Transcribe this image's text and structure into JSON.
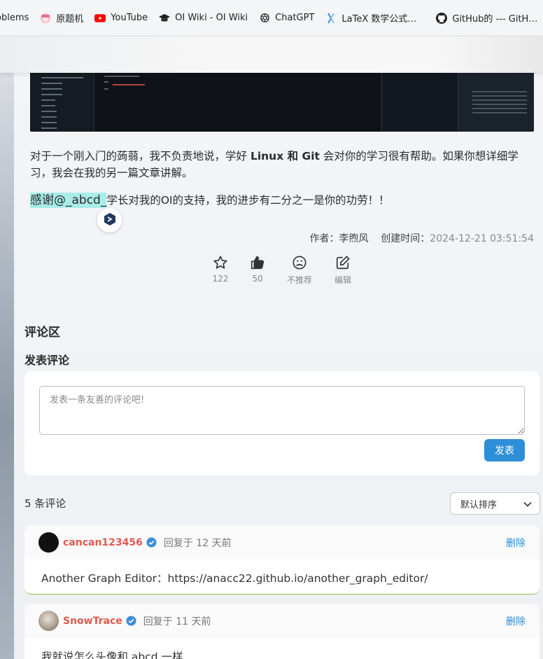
{
  "bookmarks": [
    {
      "label": "oblems",
      "icon": "none"
    },
    {
      "label": "原题机",
      "icon": "anime-avatar-icon"
    },
    {
      "label": "YouTube",
      "icon": "youtube-icon"
    },
    {
      "label": "OI Wiki - OI Wiki",
      "icon": "graduation-cap-icon"
    },
    {
      "label": "ChatGPT",
      "icon": "chatgpt-icon"
    },
    {
      "label": "LaTeX 数学公式…",
      "icon": "latex-icon"
    },
    {
      "label": "GitHub的 --- GitH…",
      "icon": "github-icon"
    }
  ],
  "article": {
    "para1_pre": "对于一个刚入门的蒟蒻，我不负责地说，学好 ",
    "para1_bold": "Linux 和 Git",
    "para1_post": " 会对你的学习很有帮助。如果你想详细学习，我会在我的另一篇文章讲解。",
    "para2_highlight": "感谢@_abcd_",
    "para2_rest": "学长对我的OI的支持，我的进步有二分之一是你的功劳！！",
    "author_label": "作者：",
    "author": "李煦风",
    "created_label": "创建时间：",
    "created_time": "2024-12-21 03:51:54"
  },
  "actions": {
    "star_count": "122",
    "like_count": "50",
    "dislike_label": "不推荐",
    "edit_label": "编辑"
  },
  "comments_section": {
    "title": "评论区",
    "post_title": "发表评论",
    "placeholder": "发表一条友善的评论吧!",
    "post_button": "发表",
    "count_text": "5 条评论",
    "sort_selected": "默认排序"
  },
  "comments": [
    {
      "user": "cancan123456",
      "reply_time": "回复于 12 天前",
      "delete_label": "删除",
      "body": "Another Graph Editor：https://anacc22.github.io/another_graph_editor/"
    },
    {
      "user": "SnowTrace",
      "reply_time": "回复于 11 天前",
      "delete_label": "删除",
      "body": "我就说怎么头像和 abcd 一样"
    }
  ]
}
